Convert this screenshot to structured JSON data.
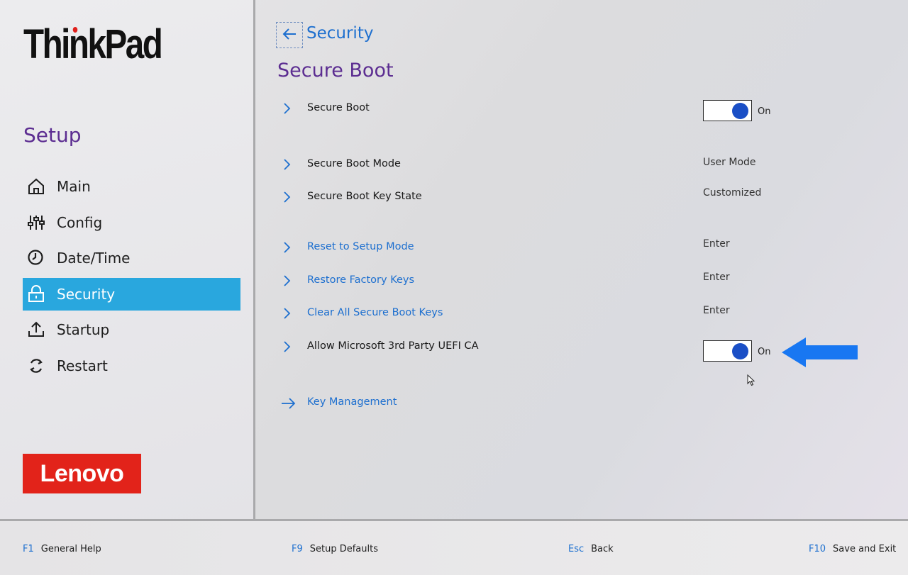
{
  "brand": {
    "thinkpad_logo": "ThinkPad",
    "lenovo_logo": "Lenovo"
  },
  "sidebar": {
    "title": "Setup",
    "items": [
      {
        "label": "Main",
        "icon": "home-icon",
        "active": false
      },
      {
        "label": "Config",
        "icon": "sliders-icon",
        "active": false
      },
      {
        "label": "Date/Time",
        "icon": "clock-icon",
        "active": false
      },
      {
        "label": "Security",
        "icon": "lock-icon",
        "active": true
      },
      {
        "label": "Startup",
        "icon": "upload-icon",
        "active": false
      },
      {
        "label": "Restart",
        "icon": "restart-icon",
        "active": false
      }
    ]
  },
  "header": {
    "breadcrumb": "Security",
    "title": "Secure Boot"
  },
  "settings": [
    {
      "label": "Secure Boot",
      "kind": "toggle",
      "value": "On"
    },
    {
      "label": "Secure Boot Mode",
      "kind": "readonly",
      "value": "User Mode"
    },
    {
      "label": "Secure Boot Key State",
      "kind": "readonly",
      "value": "Customized"
    },
    {
      "label": "Reset to Setup Mode",
      "kind": "action",
      "value": "Enter"
    },
    {
      "label": "Restore Factory Keys",
      "kind": "action",
      "value": "Enter"
    },
    {
      "label": "Clear All Secure Boot Keys",
      "kind": "action",
      "value": "Enter"
    },
    {
      "label": "Allow Microsoft 3rd Party UEFI CA",
      "kind": "toggle",
      "value": "On"
    },
    {
      "label": "Key Management",
      "kind": "submenu"
    }
  ],
  "footer": [
    {
      "key": "F1",
      "action": "General Help"
    },
    {
      "key": "F9",
      "action": "Setup Defaults"
    },
    {
      "key": "Esc",
      "action": "Back"
    },
    {
      "key": "F10",
      "action": "Save and Exit"
    }
  ],
  "colors": {
    "accent_blue": "#1d6fcf",
    "active_nav": "#29a7de",
    "title_purple": "#5c2d91",
    "toggle_knob": "#1a4fc6",
    "annotation_arrow": "#1877f2",
    "lenovo_red": "#e2231a"
  }
}
